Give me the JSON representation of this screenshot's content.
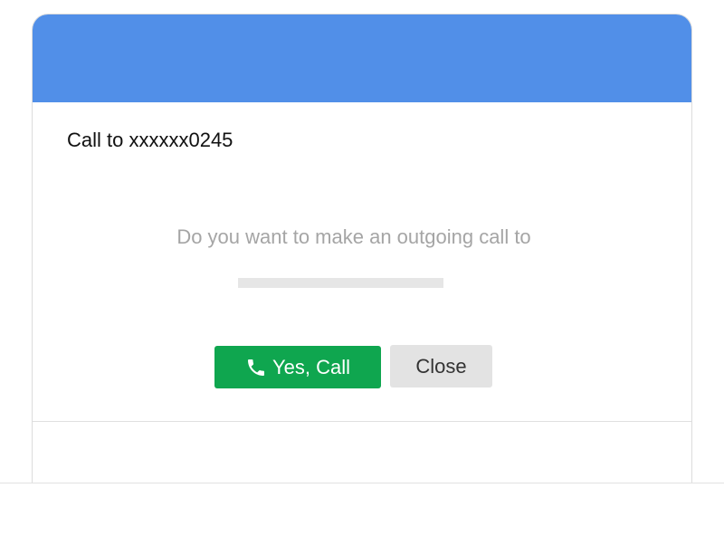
{
  "dialog": {
    "title": "Call to xxxxxx0245",
    "prompt": "Do you want to make an outgoing call to",
    "header_color": "#518fe8"
  },
  "actions": {
    "call_label": "Yes, Call",
    "call_icon": "phone-icon",
    "call_color": "#0fa64f",
    "close_label": "Close",
    "close_color": "#e3e3e3"
  }
}
